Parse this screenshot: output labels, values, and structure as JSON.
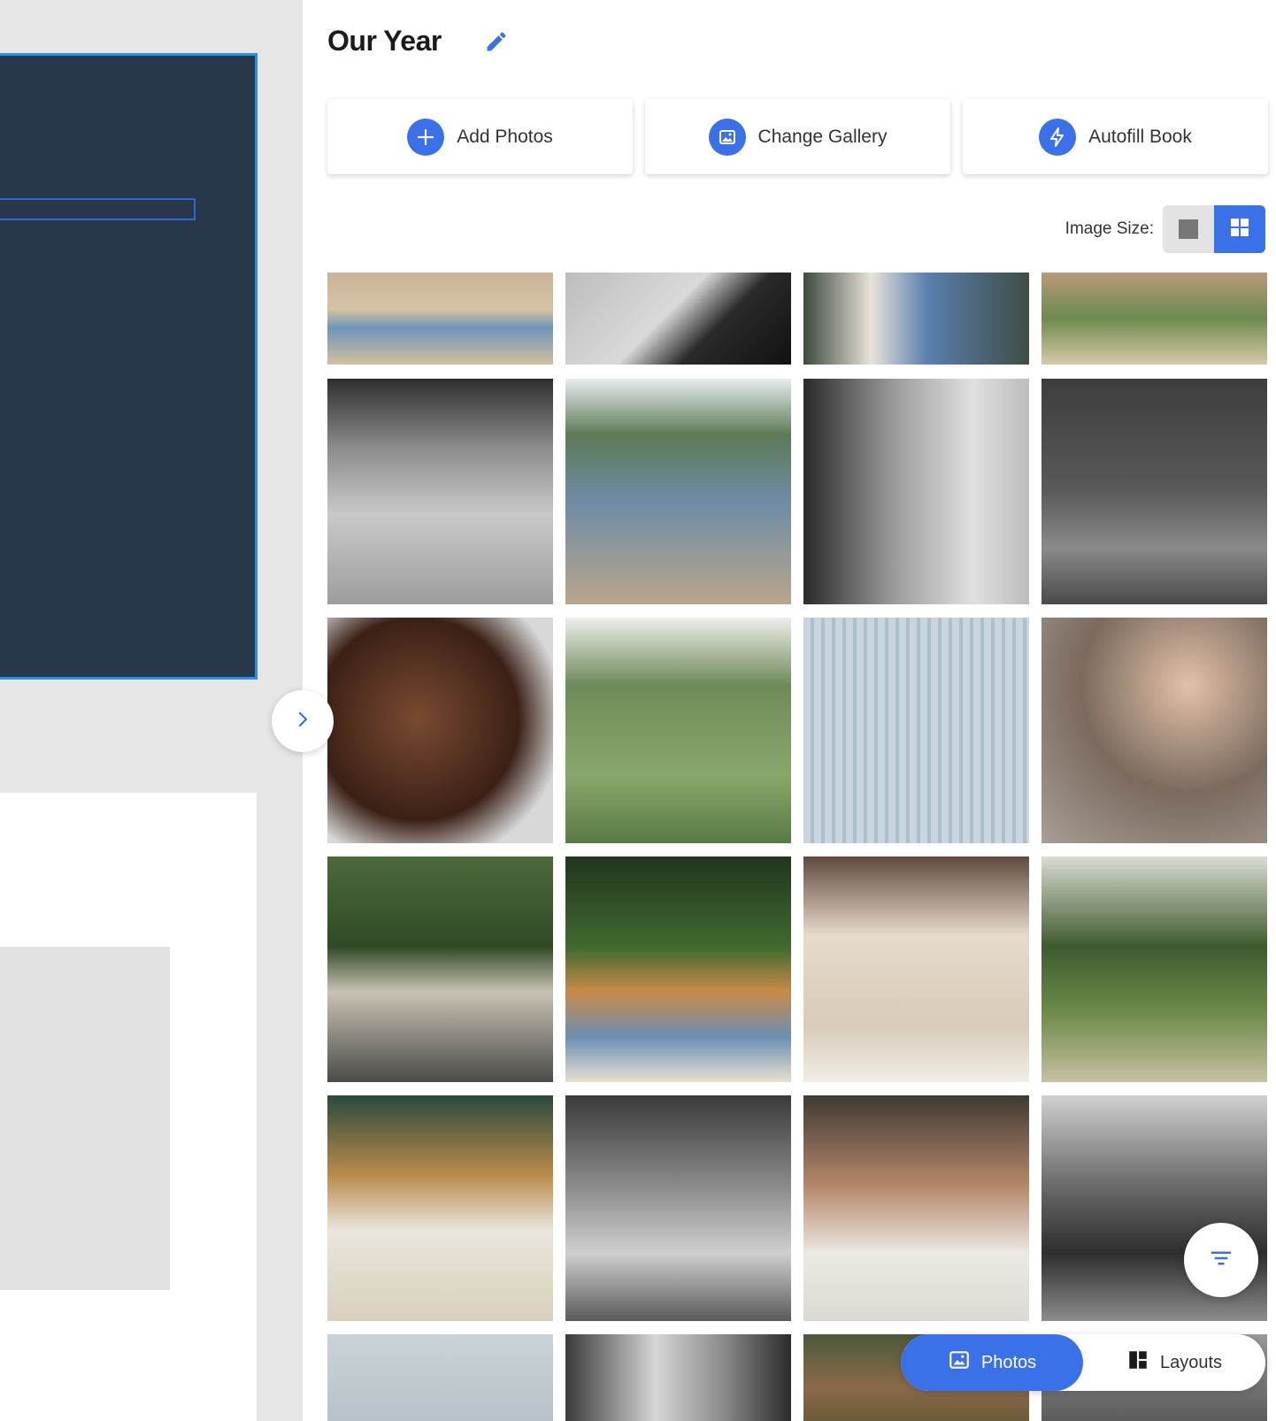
{
  "panel": {
    "title": "Our Year",
    "actions": [
      {
        "label": "Add Photos",
        "icon": "plus-icon"
      },
      {
        "label": "Change Gallery",
        "icon": "gallery-icon"
      },
      {
        "label": "Autofill Book",
        "icon": "lightning-icon"
      }
    ],
    "image_size_label": "Image Size:"
  },
  "tabs": {
    "photos_label": "Photos",
    "layouts_label": "Layouts"
  },
  "colors": {
    "accent": "#3a70e8",
    "page_dark": "#28374a",
    "selection": "#2b8cf0"
  },
  "photos": [
    {
      "alt": "child in blue shirt"
    },
    {
      "alt": "black and white hands"
    },
    {
      "alt": "children standing"
    },
    {
      "alt": "path with grass"
    },
    {
      "alt": "man holding dog"
    },
    {
      "alt": "family by lake"
    },
    {
      "alt": "smiling boy by window"
    },
    {
      "alt": "girl with candles"
    },
    {
      "alt": "sleeping baby"
    },
    {
      "alt": "couple hugging in field"
    },
    {
      "alt": "white house with windows"
    },
    {
      "alt": "mother and baby"
    },
    {
      "alt": "mother with children"
    },
    {
      "alt": "mother and baby on blanket"
    },
    {
      "alt": "baby in diaper"
    },
    {
      "alt": "tree and dirt road"
    },
    {
      "alt": "dog in car"
    },
    {
      "alt": "couple on bicycle"
    },
    {
      "alt": "family in bed"
    },
    {
      "alt": "couple in convertible"
    },
    {
      "alt": "sky"
    },
    {
      "alt": "family portrait"
    },
    {
      "alt": "forest"
    },
    {
      "alt": "black and white"
    }
  ]
}
